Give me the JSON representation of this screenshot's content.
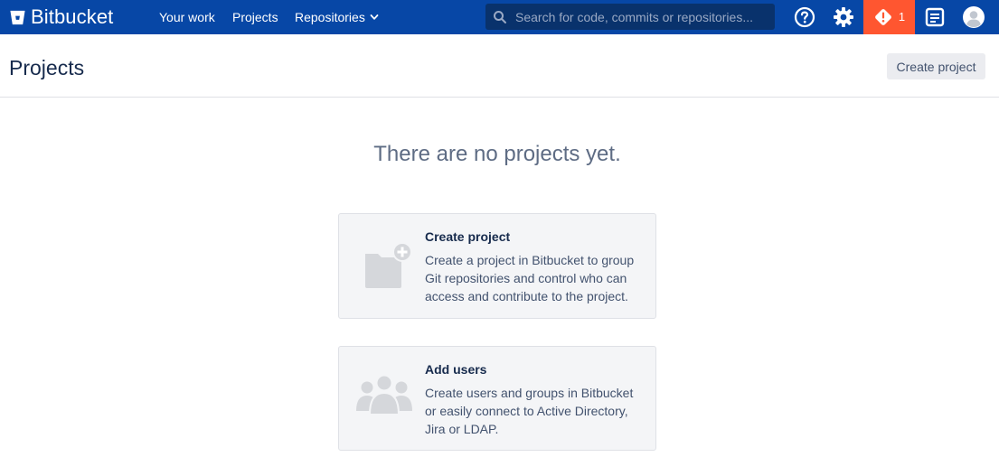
{
  "app": {
    "logo_text": "Bitbucket"
  },
  "nav": {
    "your_work": "Your work",
    "projects": "Projects",
    "repositories": "Repositories"
  },
  "search": {
    "placeholder": "Search for code, commits or repositories..."
  },
  "header_icons": {
    "alert_count": "1"
  },
  "colors": {
    "topbar": "#0747a6",
    "search_bg": "#09326c",
    "alert": "#ff5630",
    "card_bg": "#f4f5f7",
    "card_icon": "#d5d7db"
  },
  "icons": [
    "bitbucket-logo-icon",
    "chevron-down-icon",
    "search-icon",
    "help-icon",
    "gear-icon",
    "alert-icon",
    "notes-icon",
    "avatar-icon",
    "folder-plus-icon",
    "users-icon"
  ],
  "page": {
    "title": "Projects",
    "create_button": "Create project",
    "empty_heading": "There are no projects yet."
  },
  "cards": [
    {
      "title": "Create project",
      "description": "Create a project in Bitbucket to group Git repositories and control who can access and contribute to the project."
    },
    {
      "title": "Add users",
      "description": "Create users and groups in Bitbucket or easily connect to Active Directory, Jira or LDAP."
    }
  ]
}
